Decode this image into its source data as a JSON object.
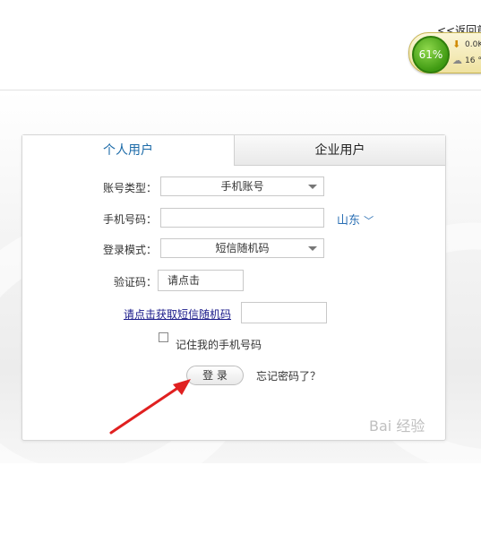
{
  "header": {
    "back_link": "<<返回首"
  },
  "widget": {
    "percent": "61%",
    "download_speed": "0.0K",
    "temperature": "16 ℃",
    "accent_color": "#3f9a12"
  },
  "tabs": [
    {
      "label": "个人用户",
      "active": true
    },
    {
      "label": "企业用户",
      "active": false
    }
  ],
  "form": {
    "account_type": {
      "label": "账号类型：",
      "value": "手机账号"
    },
    "phone": {
      "label": "手机号码：",
      "value": "",
      "region": "山东"
    },
    "login_mode": {
      "label": "登录模式：",
      "value": "短信随机码"
    },
    "captcha": {
      "label": "验证码：",
      "button": "请点击"
    },
    "sms_link": "请点击获取短信随机码",
    "remember": {
      "label": "记住我的手机号码",
      "checked": false
    },
    "login_button": "登 录",
    "forgot_password": "忘记密码了？"
  },
  "watermark": "Bai 经验"
}
